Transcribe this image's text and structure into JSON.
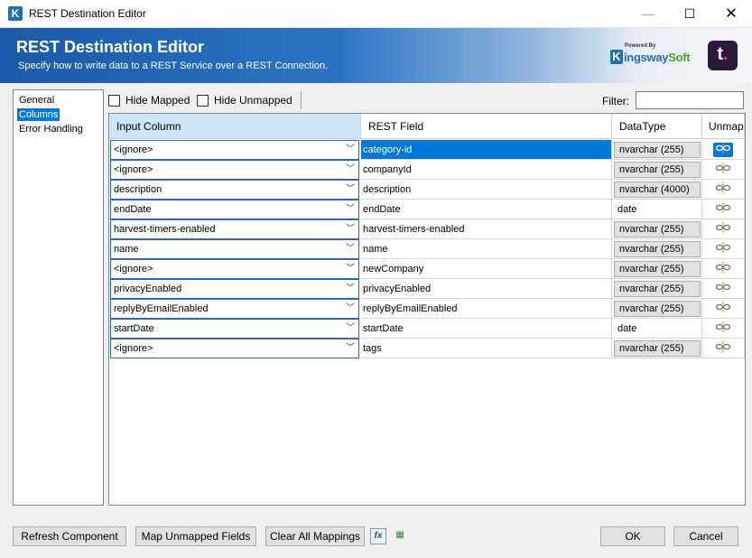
{
  "window": {
    "title": "REST Destination Editor",
    "minimize": "—",
    "maximize": "☐",
    "close": "✕"
  },
  "banner": {
    "title": "REST Destination Editor",
    "subtitle": "Specify how to write data to a REST Service over a REST Connection.",
    "brand_powered": "Powered By",
    "brand_name_a": "ingsway",
    "brand_name_b": "Soft",
    "logo_letter": "t",
    "logo_dot": "."
  },
  "nav": {
    "items": [
      {
        "label": "General"
      },
      {
        "label": "Columns"
      },
      {
        "label": "Error Handling"
      }
    ],
    "selected": 1
  },
  "toolbar": {
    "hide_mapped": "Hide Mapped",
    "hide_unmapped": "Hide Unmapped",
    "filter_label": "Filter:",
    "filter_value": ""
  },
  "grid": {
    "headers": {
      "input": "Input Column",
      "rest": "REST Field",
      "dtype": "DataType",
      "unmap": "Unmap"
    },
    "rows": [
      {
        "input": "<ignore>",
        "rest": "category-id",
        "dtype": "nvarchar (255)",
        "btn": true
      },
      {
        "input": "<ignore>",
        "rest": "companyId",
        "dtype": "nvarchar (255)",
        "btn": true
      },
      {
        "input": "description",
        "rest": "description",
        "dtype": "nvarchar (4000)",
        "btn": true
      },
      {
        "input": "endDate",
        "rest": "endDate",
        "dtype": "date",
        "btn": false
      },
      {
        "input": "harvest-timers-enabled",
        "rest": "harvest-timers-enabled",
        "dtype": "nvarchar (255)",
        "btn": true
      },
      {
        "input": "name",
        "rest": "name",
        "dtype": "nvarchar (255)",
        "btn": true
      },
      {
        "input": "<ignore>",
        "rest": "newCompany",
        "dtype": "nvarchar (255)",
        "btn": true
      },
      {
        "input": "privacyEnabled",
        "rest": "privacyEnabled",
        "dtype": "nvarchar (255)",
        "btn": true
      },
      {
        "input": "replyByEmailEnabled",
        "rest": "replyByEmailEnabled",
        "dtype": "nvarchar (255)",
        "btn": true
      },
      {
        "input": "startDate",
        "rest": "startDate",
        "dtype": "date",
        "btn": false
      },
      {
        "input": "<ignore>",
        "rest": "tags",
        "dtype": "nvarchar (255)",
        "btn": true
      }
    ],
    "selected_row": 0
  },
  "footer": {
    "refresh": "Refresh Component",
    "map_unmapped": "Map Unmapped Fields",
    "clear_all": "Clear All Mappings",
    "ok": "OK",
    "cancel": "Cancel"
  },
  "colors": {
    "accent": "#0078d7",
    "brand": "#1f6fb8"
  }
}
